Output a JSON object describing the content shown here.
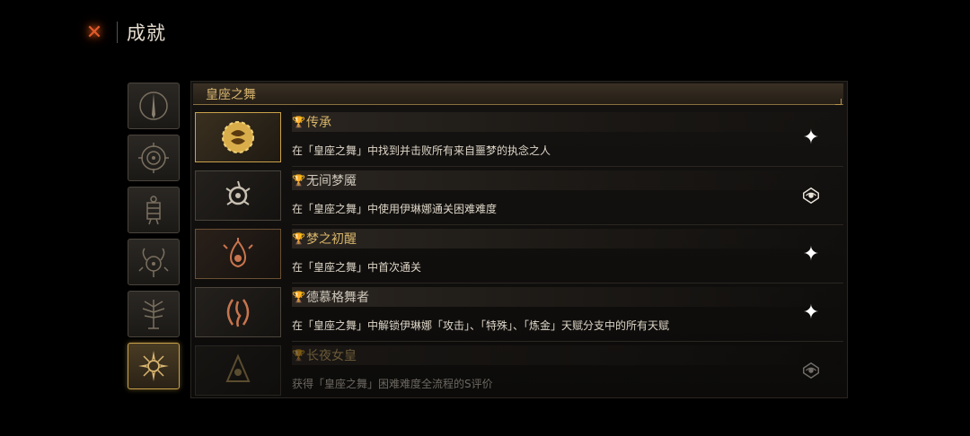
{
  "header": {
    "title": "成就",
    "close_icon": "close-x-icon"
  },
  "sidebar": {
    "tabs": [
      {
        "icon": "spire-emblem-icon",
        "active": false
      },
      {
        "icon": "spiral-sun-emblem-icon",
        "active": false
      },
      {
        "icon": "lantern-emblem-icon",
        "active": false
      },
      {
        "icon": "horned-sun-emblem-icon",
        "active": false
      },
      {
        "icon": "tree-emblem-icon",
        "active": false
      },
      {
        "icon": "radiant-emblem-icon",
        "active": true
      }
    ]
  },
  "category": {
    "title": "皇座之舞"
  },
  "achievements": [
    {
      "title": "传承",
      "desc": "在「皇座之舞」中找到并击败所有来自噩梦的执念之人",
      "reward_icon": "sparkle-icon",
      "thumb": "gold"
    },
    {
      "title": "无间梦魇",
      "desc": "在「皇座之舞」中使用伊琳娜通关困难难度",
      "reward_icon": "eye-emblem-icon",
      "thumb": "plain"
    },
    {
      "title": "梦之初醒",
      "desc": "在「皇座之舞」中首次通关",
      "reward_icon": "sparkle-icon",
      "thumb": "bronze"
    },
    {
      "title": "德慕格舞者",
      "desc": "在「皇座之舞」中解锁伊琳娜「攻击」、「特殊」、「炼金」天赋分支中的所有天赋",
      "reward_icon": "sparkle-icon",
      "thumb": "plain"
    },
    {
      "title": "长夜女皇",
      "desc": "获得「皇座之舞」困难难度全流程的S评价",
      "reward_icon": "eye-emblem-icon",
      "thumb": "plain"
    }
  ],
  "colors": {
    "accent_gold": "#d7b56b",
    "close_orange": "#e25a2a",
    "background": "#000000"
  }
}
